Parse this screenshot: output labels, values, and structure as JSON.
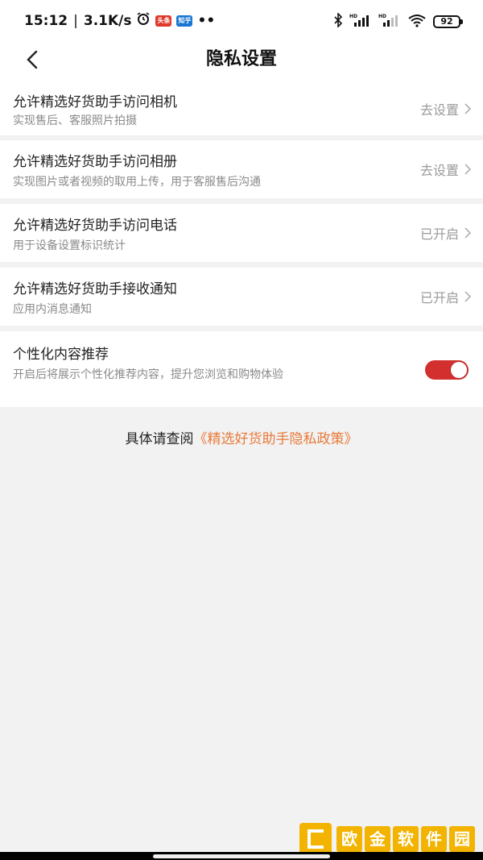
{
  "status_bar": {
    "time": "15:12",
    "net_speed": "3.1K/s",
    "notif_1": "头条",
    "notif_2": "知乎",
    "dots": "••",
    "battery": "92"
  },
  "header": {
    "title": "隐私设置"
  },
  "settings": [
    {
      "title": "允许精选好货助手访问相机",
      "desc": "实现售后、客服照片拍摄",
      "action": "去设置"
    },
    {
      "title": "允许精选好货助手访问相册",
      "desc": "实现图片或者视频的取用上传，用于客服售后沟通",
      "action": "去设置"
    },
    {
      "title": "允许精选好货助手访问电话",
      "desc": "用于设备设置标识统计",
      "action": "已开启"
    },
    {
      "title": "允许精选好货助手接收通知",
      "desc": "应用内消息通知",
      "action": "已开启"
    }
  ],
  "personalized": {
    "title": "个性化内容推荐",
    "desc": "开启后将展示个性化推荐内容，提升您浏览和购物体验",
    "enabled": true
  },
  "policy": {
    "prefix": "具体请查阅",
    "link": "《精选好货助手隐私政策》"
  },
  "watermark": {
    "chars": [
      "欧",
      "金",
      "软",
      "件",
      "园"
    ]
  },
  "colors": {
    "accent": "#d32f2f",
    "link": "#e87a3a",
    "background": "#f2f2f2"
  }
}
